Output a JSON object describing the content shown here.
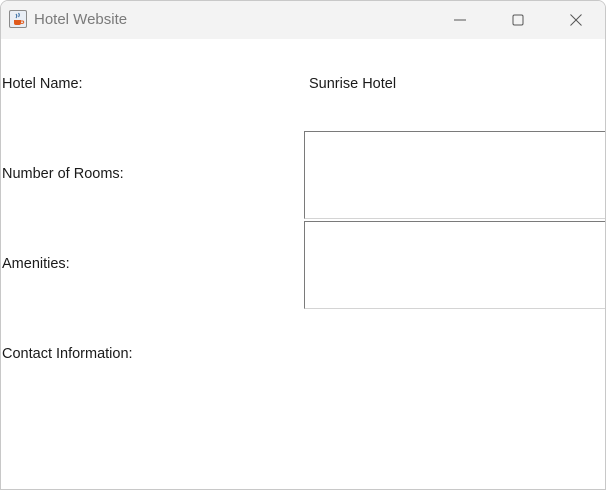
{
  "window": {
    "title": "Hotel Website",
    "app_icon": "java-cup-icon",
    "controls": [
      "minimize-icon",
      "maximize-icon",
      "close-icon"
    ]
  },
  "form": {
    "hotel_name_label": "Hotel Name:",
    "hotel_name_value": "Sunrise Hotel",
    "rooms_label": "Number of Rooms:",
    "rooms_value": "",
    "amenities_label": "Amenities:",
    "amenities_value": "",
    "contact_label": "Contact Information:"
  }
}
